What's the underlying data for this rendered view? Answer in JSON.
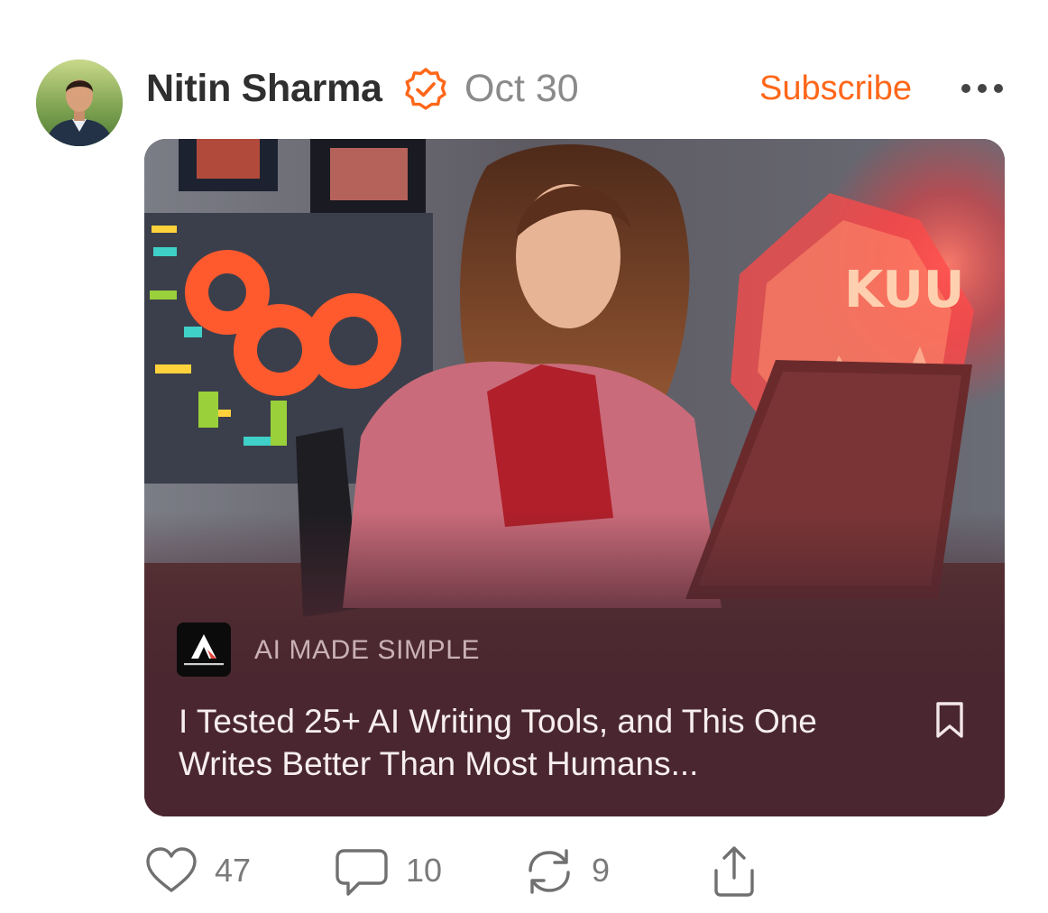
{
  "author": {
    "name": "Nitin Sharma",
    "date": "Oct 30",
    "verified_icon": "verified-check-icon",
    "verified_color": "#ff6719"
  },
  "header": {
    "subscribe_label": "Subscribe",
    "more_icon": "ellipsis-icon"
  },
  "card": {
    "publication_name": "AI MADE SIMPLE",
    "publication_logo_text": "AI Made Simple",
    "title": "I Tested 25+ AI Writing Tools, and This One Writes Better Than Most Humans...",
    "bookmark_icon": "bookmark-icon",
    "background_color": "#4a2730"
  },
  "actions": {
    "like_count": "47",
    "comment_count": "10",
    "restack_count": "9",
    "like_icon": "heart-icon",
    "comment_icon": "comment-bubble-icon",
    "restack_icon": "restack-icon",
    "share_icon": "share-icon"
  },
  "colors": {
    "accent": "#ff6719",
    "text_primary": "#2f2f2f",
    "text_muted": "#8a8a8a"
  }
}
